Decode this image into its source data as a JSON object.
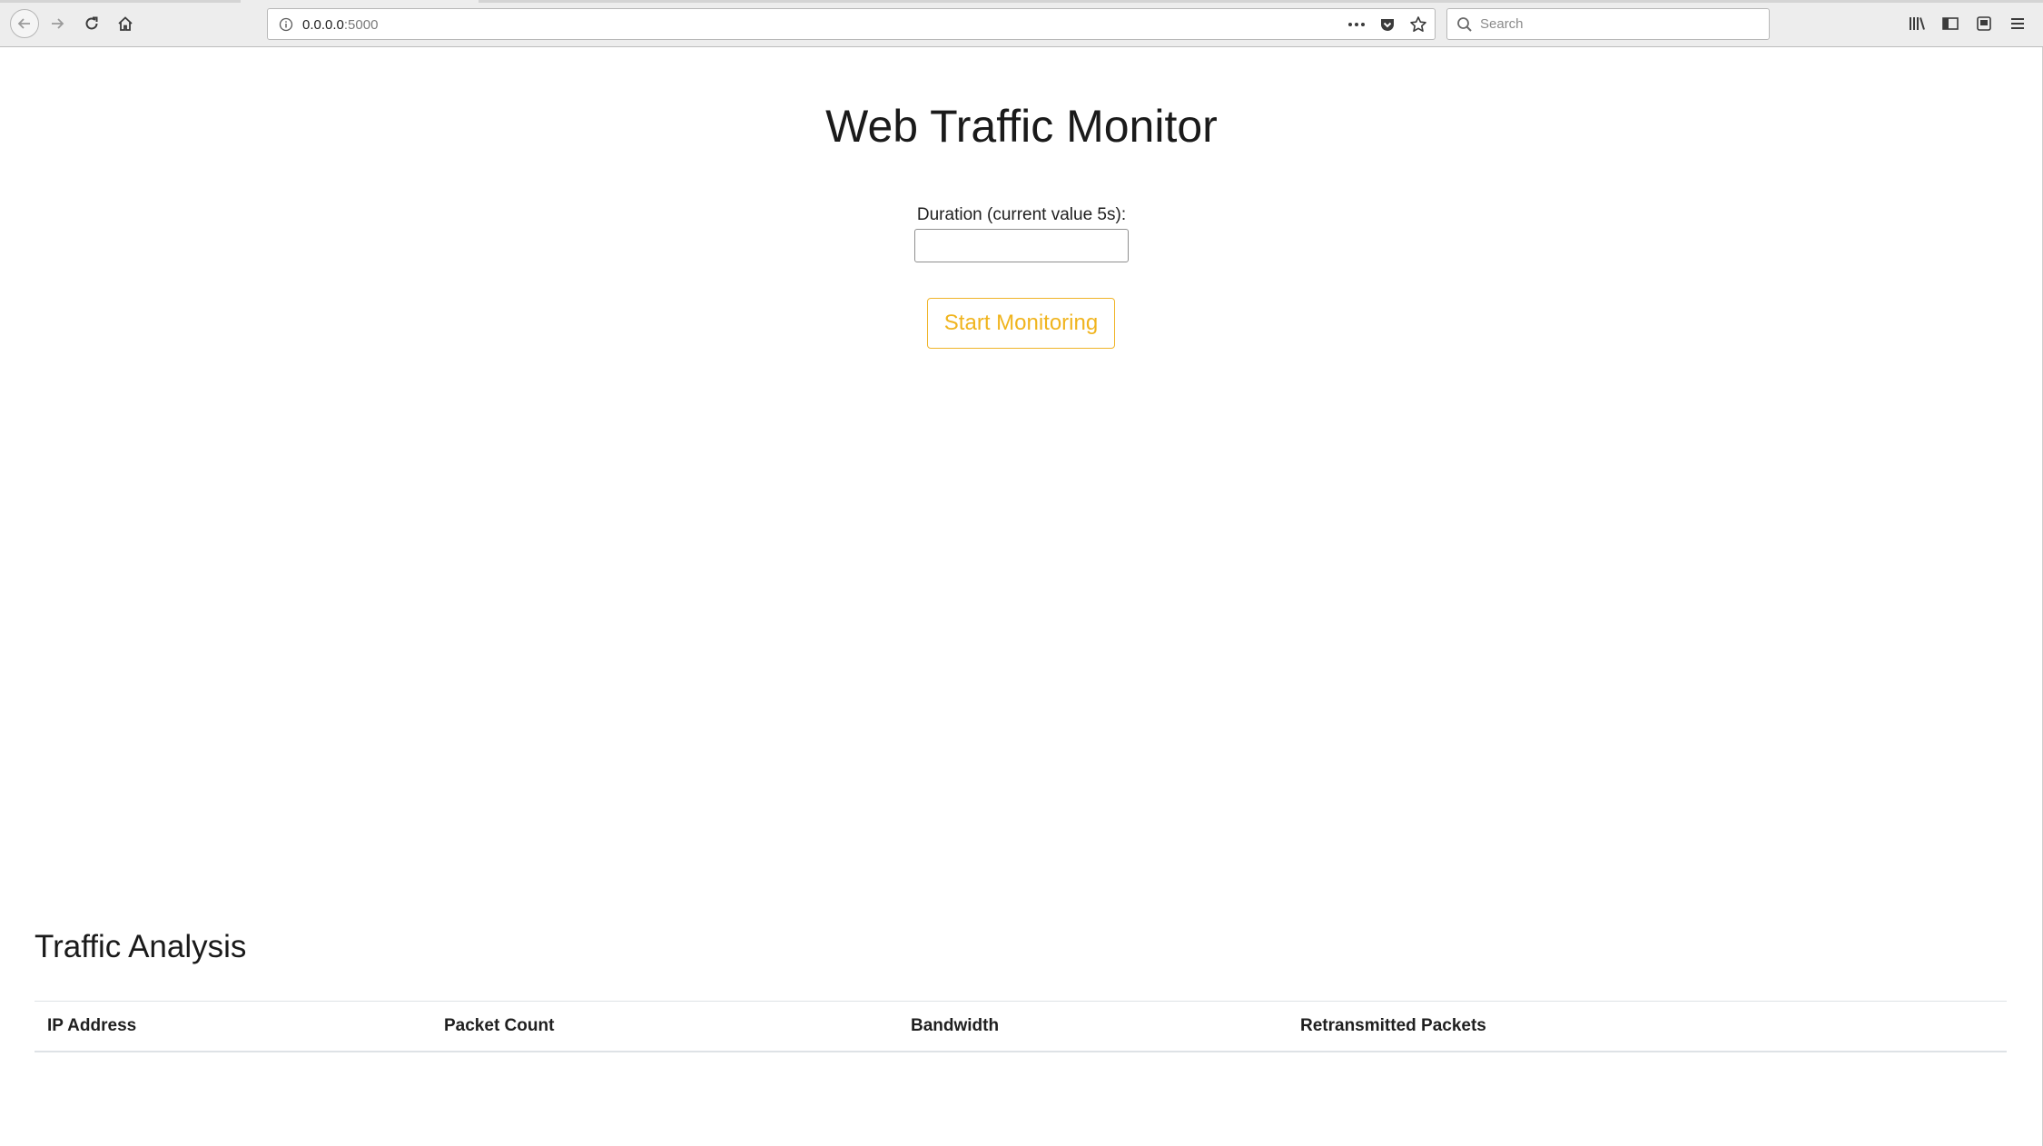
{
  "browser": {
    "url_host": "0.0.0.0",
    "url_port": ":5000",
    "search_placeholder": "Search"
  },
  "page": {
    "title": "Web Traffic Monitor",
    "duration_label": "Duration (current value 5s):",
    "duration_value": "",
    "start_button": "Start Monitoring"
  },
  "analysis": {
    "title": "Traffic Analysis",
    "columns": [
      "IP Address",
      "Packet Count",
      "Bandwidth",
      "Retransmitted Packets"
    ],
    "rows": []
  },
  "colors": {
    "accent": "#f0b41e"
  }
}
